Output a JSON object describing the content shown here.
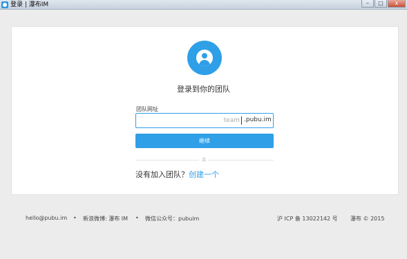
{
  "window": {
    "title": "登录 | 瀑布IM",
    "minimize": "–",
    "maximize": "□",
    "close": "x"
  },
  "login": {
    "heading": "登录到你的团队",
    "field_label": "团队网址",
    "input_placeholder": "team",
    "domain_suffix": ".pubu.im",
    "continue_label": "继续",
    "divider_text": "或",
    "no_team_text": "没有加入团队？",
    "create_link": "创建一个"
  },
  "footer": {
    "email": "hello@pubu.im",
    "separator": "•",
    "weibo": "新浪微博: 瀑布 IM",
    "wechat": "微信公众号：pubuim",
    "icp": "沪 ICP 备 13022142 号",
    "copyright": "瀑布 © 2015"
  },
  "colors": {
    "accent": "#2f9fe8",
    "background": "#ececec",
    "card": "#ffffff"
  },
  "icons": {
    "app": "app-icon",
    "avatar": "user-avatar-icon"
  }
}
